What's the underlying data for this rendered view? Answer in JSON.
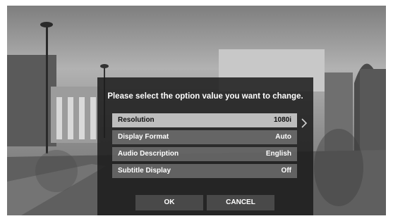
{
  "dialog": {
    "prompt": "Please select the option value you want to change.",
    "options": [
      {
        "label": "Resolution",
        "value": "1080i",
        "selected": true
      },
      {
        "label": "Display Format",
        "value": "Auto",
        "selected": false
      },
      {
        "label": "Audio Description",
        "value": "English",
        "selected": false
      },
      {
        "label": "Subtitle Display",
        "value": "Off",
        "selected": false
      }
    ],
    "selected_arrow_icon": "chevron-right-icon",
    "ok_label": "OK",
    "cancel_label": "CANCEL"
  },
  "colors": {
    "selected_row": "#bdbdbd",
    "row": "#8f8f8f",
    "panel": "#1c1c1c"
  }
}
